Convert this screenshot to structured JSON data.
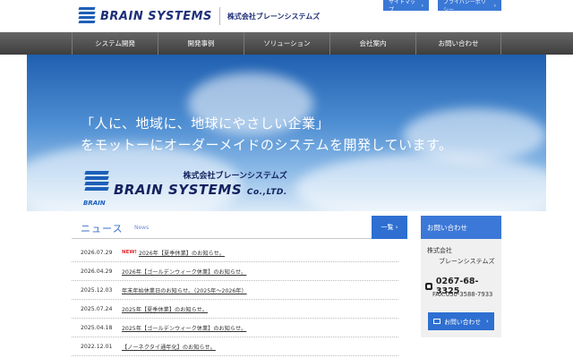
{
  "header": {
    "logo_en": "BRAIN SYSTEMS",
    "logo_ja": "株式会社ブレーンシステムズ",
    "util_links": [
      {
        "label": "サイトマップ",
        "arrow": "›"
      },
      {
        "label": "プライバシーポリシー",
        "arrow": "›"
      }
    ]
  },
  "nav": {
    "items": [
      {
        "label": "システム開発"
      },
      {
        "label": "開発事例"
      },
      {
        "label": "ソリューション"
      },
      {
        "label": "会社案内"
      },
      {
        "label": "お問い合わせ"
      }
    ]
  },
  "hero": {
    "line1": "「人に、地域に、地球にやさしい企業」",
    "line2": "をモットーにオーダーメイドのシステムを開発しています。",
    "logo_mark_text": "BRAIN",
    "logo_ja": "株式会社ブレーンシステムズ",
    "logo_en": "BRAIN SYSTEMS",
    "logo_suffix": "Co.,LTD."
  },
  "news": {
    "title": "ニュース",
    "subtitle": "News",
    "all_label": "一覧",
    "all_arrow": "›",
    "items": [
      {
        "date": "2026.07.29",
        "badge": "NEW!",
        "text": "2026年【夏季休業】のお知らせ。"
      },
      {
        "date": "2026.04.29",
        "badge": "",
        "text": "2026年【ゴールデンウィーク休業】のお知らせ。"
      },
      {
        "date": "2025.12.03",
        "badge": "",
        "text": "年末年始休業日のお知らせ。（2025年～2026年）"
      },
      {
        "date": "2025.07.24",
        "badge": "",
        "text": "2025年【夏季休業】のお知らせ。"
      },
      {
        "date": "2025.04.18",
        "badge": "",
        "text": "2025年【ゴールデンウィーク休業】のお知らせ。"
      },
      {
        "date": "2022.12.01",
        "badge": "",
        "text": "【ノーネクタイ通年化】のお知らせ。"
      }
    ]
  },
  "contact": {
    "title": "お問い合わせ",
    "company_line1": "株式会社",
    "company_line2": "ブレーンシステムズ",
    "tel": "0267-68-3325",
    "fax": "FAX:050-3588-7933",
    "button_label": "お問い合わせ",
    "button_arrow": "›"
  },
  "colors": {
    "accent": "#2e6fd1",
    "nav_bg": "#4a4a4a",
    "new_badge": "#e0262b"
  }
}
